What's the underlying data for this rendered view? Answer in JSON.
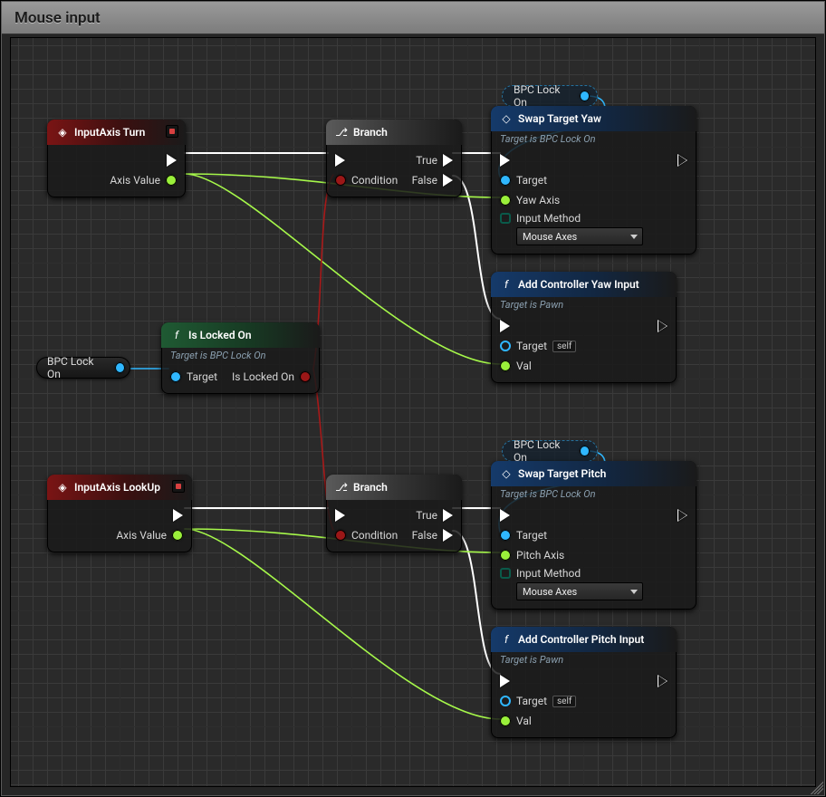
{
  "title": "Mouse input",
  "pills": {
    "bpcLockOn": "BPC Lock On"
  },
  "nodes": {
    "inputAxisTurn": {
      "title": "InputAxis Turn",
      "axisValue": "Axis Value"
    },
    "inputAxisLookUp": {
      "title": "InputAxis LookUp",
      "axisValue": "Axis Value"
    },
    "branch": {
      "title": "Branch",
      "condition": "Condition",
      "true": "True",
      "false": "False"
    },
    "isLockedOn": {
      "title": "Is Locked On",
      "sub": "Target is BPC Lock On",
      "target": "Target",
      "out": "Is Locked On"
    },
    "swapYaw": {
      "title": "Swap Target Yaw",
      "sub": "Target is BPC Lock On",
      "target": "Target",
      "axis": "Yaw Axis",
      "method": "Input Method",
      "methodValue": "Mouse Axes"
    },
    "swapPitch": {
      "title": "Swap Target Pitch",
      "sub": "Target is BPC Lock On",
      "target": "Target",
      "axis": "Pitch Axis",
      "method": "Input Method",
      "methodValue": "Mouse Axes"
    },
    "addYaw": {
      "title": "Add Controller Yaw Input",
      "sub": "Target is Pawn",
      "target": "Target",
      "self": "self",
      "val": "Val"
    },
    "addPitch": {
      "title": "Add Controller Pitch Input",
      "sub": "Target is Pawn",
      "target": "Target",
      "self": "self",
      "val": "Val"
    }
  }
}
